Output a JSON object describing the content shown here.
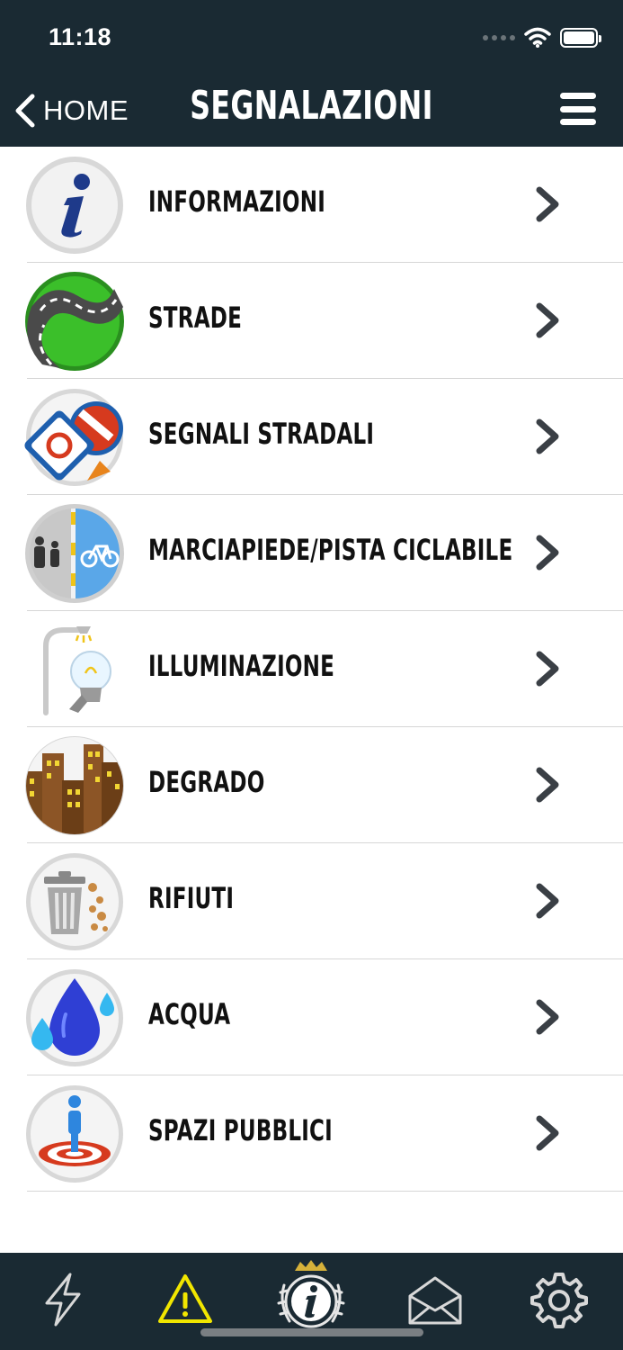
{
  "status": {
    "time": "11:18"
  },
  "nav": {
    "back_label": "HOME",
    "title": "SEGNALAZIONI"
  },
  "items": [
    {
      "label": "INFORMAZIONI",
      "icon": "info-icon"
    },
    {
      "label": "STRADE",
      "icon": "road-icon"
    },
    {
      "label": "SEGNALI STRADALI",
      "icon": "road-signs-icon"
    },
    {
      "label": "MARCIAPIEDE/PISTA CICLABILE",
      "icon": "sidewalk-bike-lane-icon"
    },
    {
      "label": "ILLUMINAZIONE",
      "icon": "street-light-icon"
    },
    {
      "label": "DEGRADO",
      "icon": "buildings-icon"
    },
    {
      "label": "RIFIUTI",
      "icon": "trash-bin-icon"
    },
    {
      "label": "ACQUA",
      "icon": "water-drop-icon"
    },
    {
      "label": "SPAZI PUBBLICI",
      "icon": "public-space-icon"
    }
  ],
  "tabbar": {
    "tabs": [
      "lightning-icon",
      "warning-icon",
      "city-info-icon",
      "envelope-icon",
      "gear-icon"
    ],
    "active": "warning-icon",
    "active_color": "#f1e600"
  },
  "colors": {
    "header_bg": "#1a2a33",
    "chevron": "#3a3f45"
  }
}
